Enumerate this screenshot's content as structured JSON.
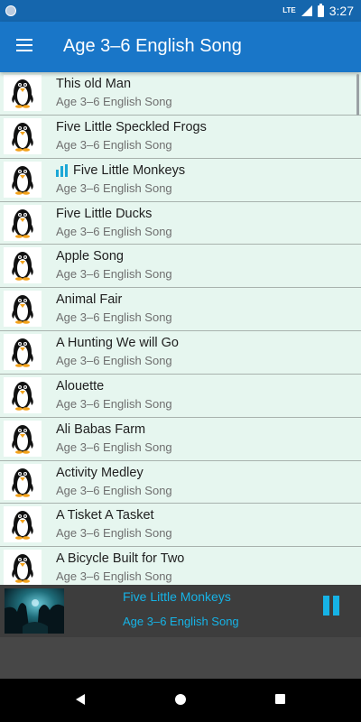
{
  "status_bar": {
    "network_label": "LTE",
    "time": "3:27",
    "icons": [
      "notification-icon",
      "lte-icon",
      "signal-icon",
      "battery-icon"
    ]
  },
  "app_bar": {
    "title": "Age 3–6 English Song",
    "menu_icon": "menu-icon"
  },
  "song_list": {
    "thumbnail_icon": "penguin-icon",
    "playing_color": "#1ca7d6",
    "items": [
      {
        "title": "This old Man",
        "subtitle": "Age 3–6 English Song",
        "playing": false
      },
      {
        "title": "Five Little Speckled Frogs",
        "subtitle": "Age 3–6 English Song",
        "playing": false
      },
      {
        "title": "Five Little Monkeys",
        "subtitle": "Age 3–6 English Song",
        "playing": true
      },
      {
        "title": "Five Little Ducks",
        "subtitle": "Age 3–6 English Song",
        "playing": false
      },
      {
        "title": "Apple Song",
        "subtitle": "Age 3–6 English Song",
        "playing": false
      },
      {
        "title": "Animal Fair",
        "subtitle": "Age 3–6 English Song",
        "playing": false
      },
      {
        "title": "A Hunting We will Go",
        "subtitle": "Age 3–6 English Song",
        "playing": false
      },
      {
        "title": "Alouette",
        "subtitle": "Age 3–6 English Song",
        "playing": false
      },
      {
        "title": "Ali Babas Farm",
        "subtitle": "Age 3–6 English Song",
        "playing": false
      },
      {
        "title": "Activity Medley",
        "subtitle": "Age 3–6 English Song",
        "playing": false
      },
      {
        "title": "A Tisket A Tasket",
        "subtitle": "Age 3–6 English Song",
        "playing": false
      },
      {
        "title": "A Bicycle Built for Two",
        "subtitle": "Age 3–6 English Song",
        "playing": false
      }
    ]
  },
  "mini_player": {
    "title": "Five Little Monkeys",
    "subtitle": "Age 3–6 English Song",
    "accent_color": "#16b3e6",
    "state_icon": "pause-icon"
  },
  "nav_bar": {
    "icons": [
      "back-icon",
      "home-icon",
      "recents-icon"
    ]
  },
  "colors": {
    "status_bar": "#1566ad",
    "app_bar": "#1976c8",
    "list_background": "#e6f6ef",
    "player_background": "#3d3d3d"
  }
}
